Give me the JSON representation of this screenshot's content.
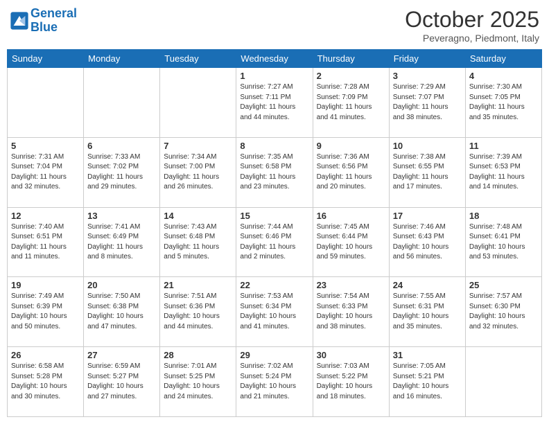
{
  "header": {
    "logo_line1": "General",
    "logo_line2": "Blue",
    "month": "October 2025",
    "location": "Peveragno, Piedmont, Italy"
  },
  "weekdays": [
    "Sunday",
    "Monday",
    "Tuesday",
    "Wednesday",
    "Thursday",
    "Friday",
    "Saturday"
  ],
  "weeks": [
    [
      {
        "day": "",
        "info": ""
      },
      {
        "day": "",
        "info": ""
      },
      {
        "day": "",
        "info": ""
      },
      {
        "day": "1",
        "info": "Sunrise: 7:27 AM\nSunset: 7:11 PM\nDaylight: 11 hours\nand 44 minutes."
      },
      {
        "day": "2",
        "info": "Sunrise: 7:28 AM\nSunset: 7:09 PM\nDaylight: 11 hours\nand 41 minutes."
      },
      {
        "day": "3",
        "info": "Sunrise: 7:29 AM\nSunset: 7:07 PM\nDaylight: 11 hours\nand 38 minutes."
      },
      {
        "day": "4",
        "info": "Sunrise: 7:30 AM\nSunset: 7:05 PM\nDaylight: 11 hours\nand 35 minutes."
      }
    ],
    [
      {
        "day": "5",
        "info": "Sunrise: 7:31 AM\nSunset: 7:04 PM\nDaylight: 11 hours\nand 32 minutes."
      },
      {
        "day": "6",
        "info": "Sunrise: 7:33 AM\nSunset: 7:02 PM\nDaylight: 11 hours\nand 29 minutes."
      },
      {
        "day": "7",
        "info": "Sunrise: 7:34 AM\nSunset: 7:00 PM\nDaylight: 11 hours\nand 26 minutes."
      },
      {
        "day": "8",
        "info": "Sunrise: 7:35 AM\nSunset: 6:58 PM\nDaylight: 11 hours\nand 23 minutes."
      },
      {
        "day": "9",
        "info": "Sunrise: 7:36 AM\nSunset: 6:56 PM\nDaylight: 11 hours\nand 20 minutes."
      },
      {
        "day": "10",
        "info": "Sunrise: 7:38 AM\nSunset: 6:55 PM\nDaylight: 11 hours\nand 17 minutes."
      },
      {
        "day": "11",
        "info": "Sunrise: 7:39 AM\nSunset: 6:53 PM\nDaylight: 11 hours\nand 14 minutes."
      }
    ],
    [
      {
        "day": "12",
        "info": "Sunrise: 7:40 AM\nSunset: 6:51 PM\nDaylight: 11 hours\nand 11 minutes."
      },
      {
        "day": "13",
        "info": "Sunrise: 7:41 AM\nSunset: 6:49 PM\nDaylight: 11 hours\nand 8 minutes."
      },
      {
        "day": "14",
        "info": "Sunrise: 7:43 AM\nSunset: 6:48 PM\nDaylight: 11 hours\nand 5 minutes."
      },
      {
        "day": "15",
        "info": "Sunrise: 7:44 AM\nSunset: 6:46 PM\nDaylight: 11 hours\nand 2 minutes."
      },
      {
        "day": "16",
        "info": "Sunrise: 7:45 AM\nSunset: 6:44 PM\nDaylight: 10 hours\nand 59 minutes."
      },
      {
        "day": "17",
        "info": "Sunrise: 7:46 AM\nSunset: 6:43 PM\nDaylight: 10 hours\nand 56 minutes."
      },
      {
        "day": "18",
        "info": "Sunrise: 7:48 AM\nSunset: 6:41 PM\nDaylight: 10 hours\nand 53 minutes."
      }
    ],
    [
      {
        "day": "19",
        "info": "Sunrise: 7:49 AM\nSunset: 6:39 PM\nDaylight: 10 hours\nand 50 minutes."
      },
      {
        "day": "20",
        "info": "Sunrise: 7:50 AM\nSunset: 6:38 PM\nDaylight: 10 hours\nand 47 minutes."
      },
      {
        "day": "21",
        "info": "Sunrise: 7:51 AM\nSunset: 6:36 PM\nDaylight: 10 hours\nand 44 minutes."
      },
      {
        "day": "22",
        "info": "Sunrise: 7:53 AM\nSunset: 6:34 PM\nDaylight: 10 hours\nand 41 minutes."
      },
      {
        "day": "23",
        "info": "Sunrise: 7:54 AM\nSunset: 6:33 PM\nDaylight: 10 hours\nand 38 minutes."
      },
      {
        "day": "24",
        "info": "Sunrise: 7:55 AM\nSunset: 6:31 PM\nDaylight: 10 hours\nand 35 minutes."
      },
      {
        "day": "25",
        "info": "Sunrise: 7:57 AM\nSunset: 6:30 PM\nDaylight: 10 hours\nand 32 minutes."
      }
    ],
    [
      {
        "day": "26",
        "info": "Sunrise: 6:58 AM\nSunset: 5:28 PM\nDaylight: 10 hours\nand 30 minutes."
      },
      {
        "day": "27",
        "info": "Sunrise: 6:59 AM\nSunset: 5:27 PM\nDaylight: 10 hours\nand 27 minutes."
      },
      {
        "day": "28",
        "info": "Sunrise: 7:01 AM\nSunset: 5:25 PM\nDaylight: 10 hours\nand 24 minutes."
      },
      {
        "day": "29",
        "info": "Sunrise: 7:02 AM\nSunset: 5:24 PM\nDaylight: 10 hours\nand 21 minutes."
      },
      {
        "day": "30",
        "info": "Sunrise: 7:03 AM\nSunset: 5:22 PM\nDaylight: 10 hours\nand 18 minutes."
      },
      {
        "day": "31",
        "info": "Sunrise: 7:05 AM\nSunset: 5:21 PM\nDaylight: 10 hours\nand 16 minutes."
      },
      {
        "day": "",
        "info": ""
      }
    ]
  ]
}
